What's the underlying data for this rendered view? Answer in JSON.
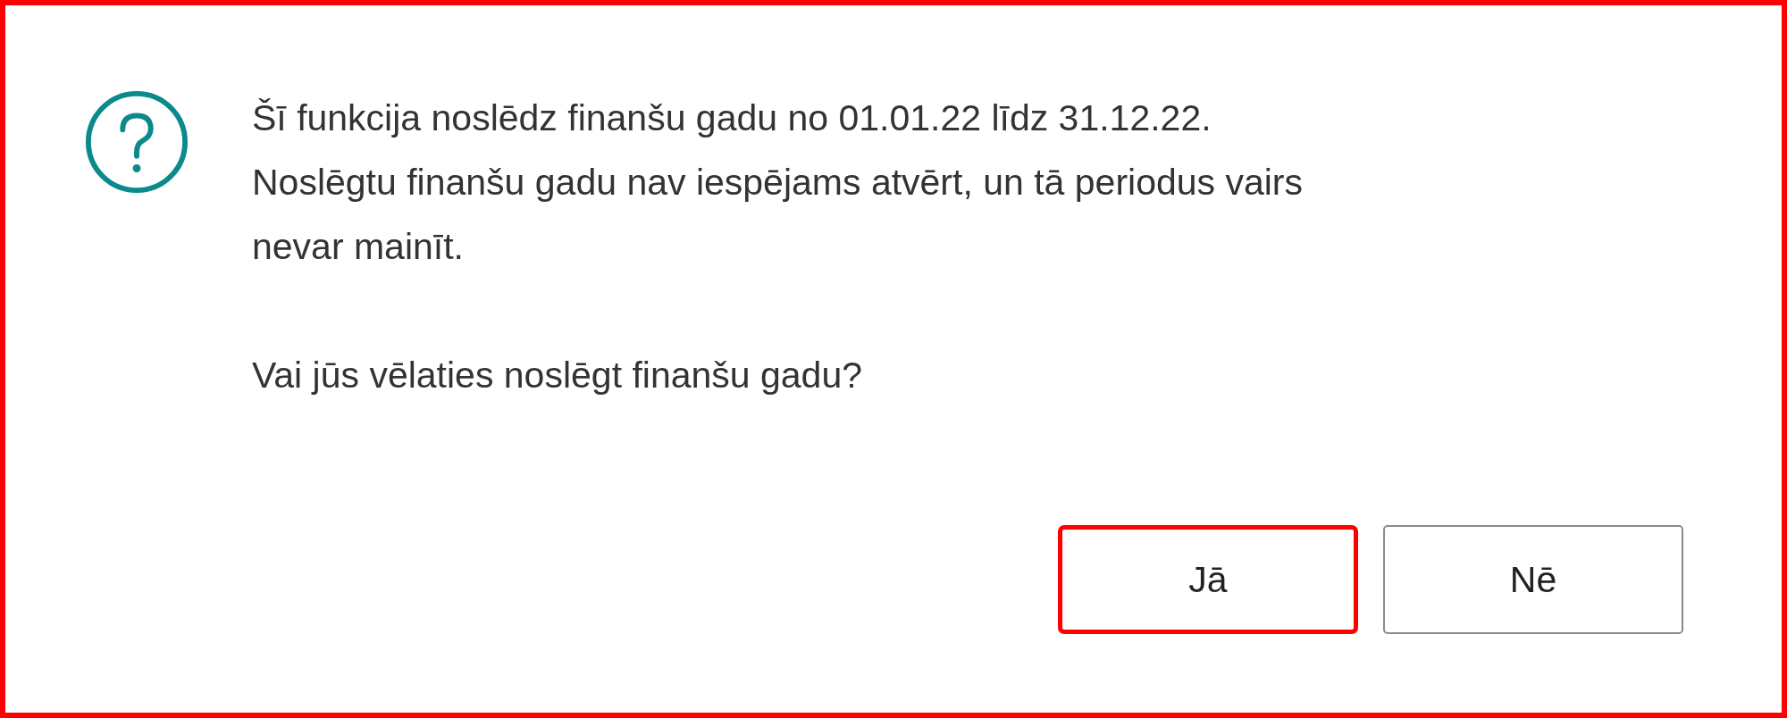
{
  "dialog": {
    "message_lines": [
      "Šī funkcija noslēdz finanšu gadu no 01.01.22 līdz 31.12.22.",
      "Noslēgtu finanšu gadu nav iespējams atvērt, un tā periodus vairs",
      "nevar mainīt."
    ],
    "question": "Vai jūs vēlaties noslēgt finanšu gadu?",
    "buttons": [
      {
        "label": "Jā",
        "highlighted": true
      },
      {
        "label": "Nē",
        "highlighted": false
      }
    ]
  }
}
